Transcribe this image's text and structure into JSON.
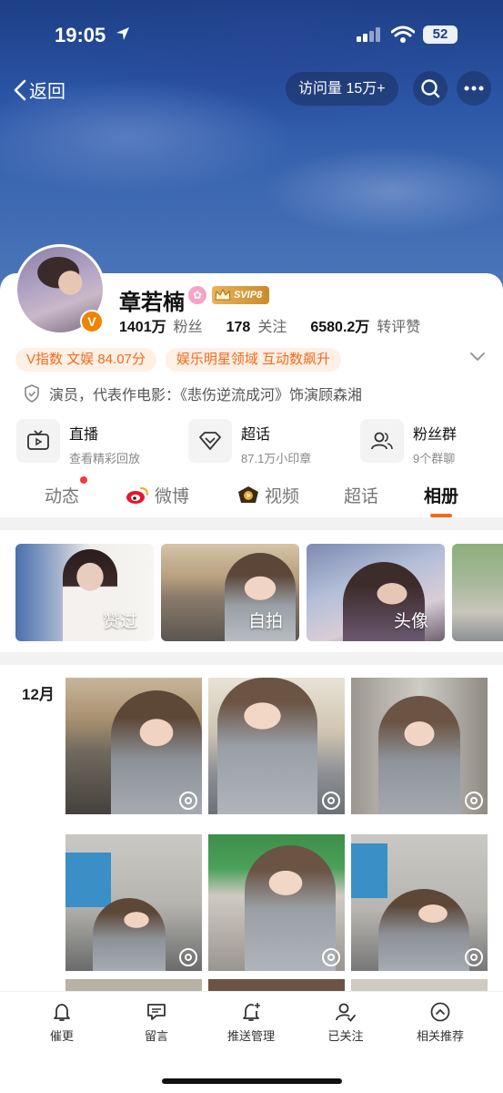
{
  "status_bar": {
    "time": "19:05",
    "battery": "52"
  },
  "nav": {
    "back_label": "返回",
    "visits": "访问量 15万+"
  },
  "profile": {
    "name": "章若楠",
    "svip": "SVIP8",
    "verified_badge": "V",
    "stats": [
      {
        "num": "1401万",
        "label": "粉丝"
      },
      {
        "num": "178",
        "label": "关注"
      },
      {
        "num": "6580.2万",
        "label": "转评赞"
      }
    ],
    "tags": [
      "V指数 文娱 84.07分",
      "娱乐明星领域 互动数飙升"
    ],
    "description": "演员，代表作电影：《悲伤逆流成河》饰演顾森湘"
  },
  "features": [
    {
      "title": "直播",
      "sub": "查看精彩回放",
      "icon": "tv-icon"
    },
    {
      "title": "超话",
      "sub": "87.1万小印章",
      "icon": "diamond-icon"
    },
    {
      "title": "粉丝群",
      "sub": "9个群聊",
      "icon": "group-icon"
    }
  ],
  "tabs": [
    "动态",
    "微博",
    "视频",
    "超话",
    "相册"
  ],
  "active_tab": "相册",
  "albums": [
    {
      "label": "赞过"
    },
    {
      "label": "自拍"
    },
    {
      "label": "头像"
    },
    {
      "label": ""
    }
  ],
  "photos": {
    "month": "12月"
  },
  "bottom_bar": [
    "催更",
    "留言",
    "推送管理",
    "已关注",
    "相关推荐"
  ],
  "colors": {
    "accent": "#f46a1c",
    "verified": "#f08300",
    "tag_bg": "#fff0e6"
  }
}
